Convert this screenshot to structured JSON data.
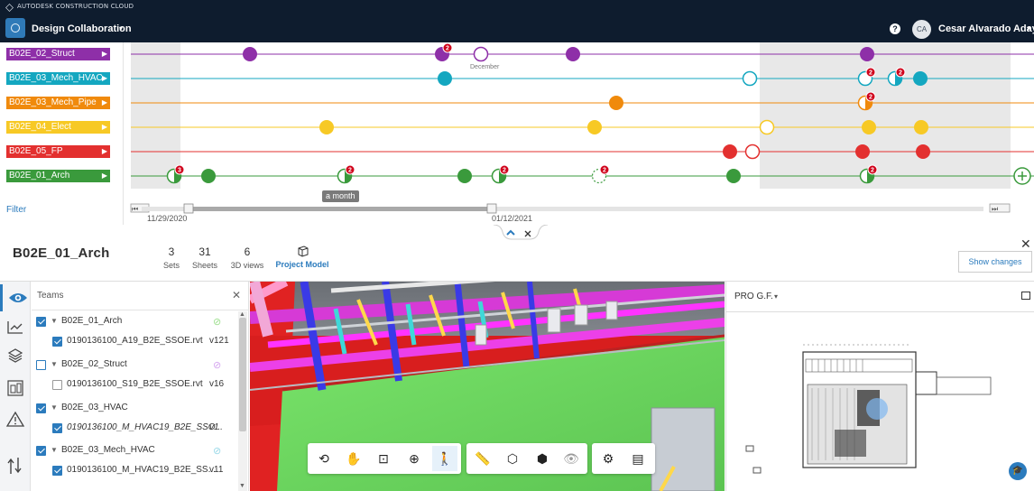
{
  "brand": {
    "name": "AUTODESK CONSTRUCTION CLOUD"
  },
  "app": {
    "title": "Design Collaboration"
  },
  "user": {
    "initials": "CA",
    "name": "Cesar Alvarado Adaya"
  },
  "timeline": {
    "packages": [
      {
        "label": "B02E_02_Struct",
        "color": "#8e2fa8"
      },
      {
        "label": "B02E_03_Mech_HVAC",
        "color": "#14a7c0"
      },
      {
        "label": "B02E_03_Mech_Pipe",
        "color": "#f08a0c"
      },
      {
        "label": "B02E_04_Elect",
        "color": "#f7c925"
      },
      {
        "label": "B02E_05_FP",
        "color": "#e3302f"
      },
      {
        "label": "B02E_01_Arch",
        "color": "#3a9a3c"
      }
    ],
    "filter_label": "Filter",
    "month_label": "December",
    "scale_tooltip": "a month",
    "start_date": "11/29/2020",
    "current_date": "01/12/2021",
    "badges": [
      "2",
      "2",
      "2",
      "2",
      "3",
      "2",
      "2",
      "2",
      "2"
    ]
  },
  "model": {
    "title": "B02E_01_Arch",
    "stats": [
      {
        "num": "3",
        "label": "Sets"
      },
      {
        "num": "31",
        "label": "Sheets"
      },
      {
        "num": "6",
        "label": "3D views"
      },
      {
        "num": "",
        "label": "Project Model"
      }
    ],
    "show_changes": "Show changes"
  },
  "teams": {
    "title": "Teams",
    "items": [
      {
        "team": "B02E_01_Arch",
        "team_checked": true,
        "file": "0190136100_A19_B2E_SSOE.rvt",
        "version": "v121",
        "file_checked": true,
        "italic": false,
        "eye_color": "#9ee08f"
      },
      {
        "team": "B02E_02_Struct",
        "team_checked": false,
        "file": "0190136100_S19_B2E_SSOE.rvt",
        "version": "v16",
        "file_checked": false,
        "italic": false,
        "eye_color": "#d6a6f0"
      },
      {
        "team": "B02E_03_HVAC",
        "team_checked": true,
        "file": "0190136100_M_HVAC19_B2E_SSO...",
        "version": "v1",
        "file_checked": true,
        "italic": true,
        "eye_color": ""
      },
      {
        "team": "B02E_03_Mech_HVAC",
        "team_checked": true,
        "file": "0190136100_M_HVAC19_B2E_SS...",
        "version": "v11",
        "file_checked": true,
        "italic": false,
        "eye_color": "#9ad9e8"
      }
    ]
  },
  "sheet": {
    "title": "PRO G.F."
  },
  "icons": {
    "rail": [
      "eye-icon",
      "chart-icon",
      "layers-icon",
      "sheet-icon",
      "warning-icon",
      "compare-icon"
    ],
    "toolbar": [
      "orbit-icon",
      "pan-icon",
      "fit-icon",
      "zoom-window-icon",
      "first-person-icon",
      "measure-icon",
      "section-icon",
      "explode-icon",
      "hide-icon",
      "settings-icon",
      "properties-icon"
    ]
  }
}
